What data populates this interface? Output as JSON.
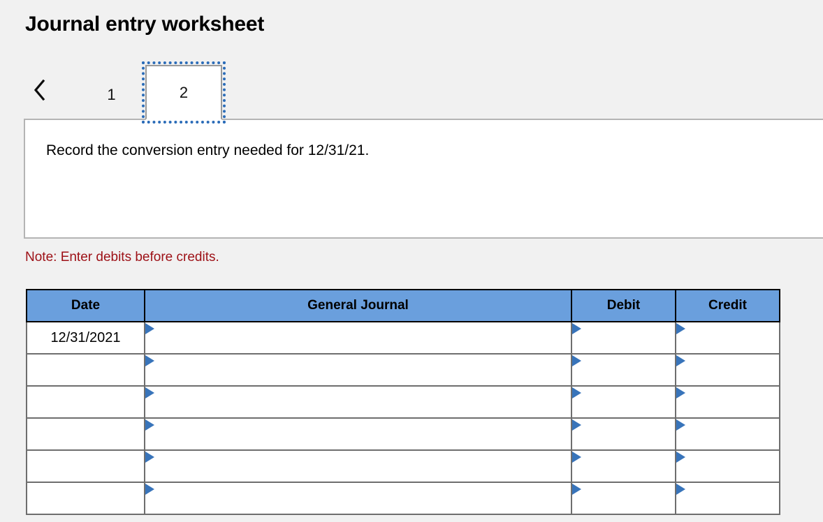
{
  "page": {
    "title": "Journal entry worksheet",
    "background_color": "#f1f1f1"
  },
  "tabs": {
    "prev_icon": "chevron-left-icon",
    "items": [
      {
        "label": "1",
        "active": false
      },
      {
        "label": "2",
        "active": true
      }
    ],
    "active_index": 1,
    "focus_outline_color": "#2b6cb8"
  },
  "content_panel": {
    "instruction": "Record the conversion entry needed for 12/31/21."
  },
  "note": {
    "text": "Note: Enter debits before credits.",
    "color": "#9d1016"
  },
  "journal": {
    "header_color": "#6a9fdd",
    "input_border_color": "#3874ba",
    "columns": [
      "Date",
      "General Journal",
      "Debit",
      "Credit"
    ],
    "rows": [
      {
        "date": "12/31/2021",
        "general_journal": "",
        "debit": "",
        "credit": ""
      },
      {
        "date": "",
        "general_journal": "",
        "debit": "",
        "credit": ""
      },
      {
        "date": "",
        "general_journal": "",
        "debit": "",
        "credit": ""
      },
      {
        "date": "",
        "general_journal": "",
        "debit": "",
        "credit": ""
      },
      {
        "date": "",
        "general_journal": "",
        "debit": "",
        "credit": ""
      },
      {
        "date": "",
        "general_journal": "",
        "debit": "",
        "credit": ""
      }
    ]
  }
}
